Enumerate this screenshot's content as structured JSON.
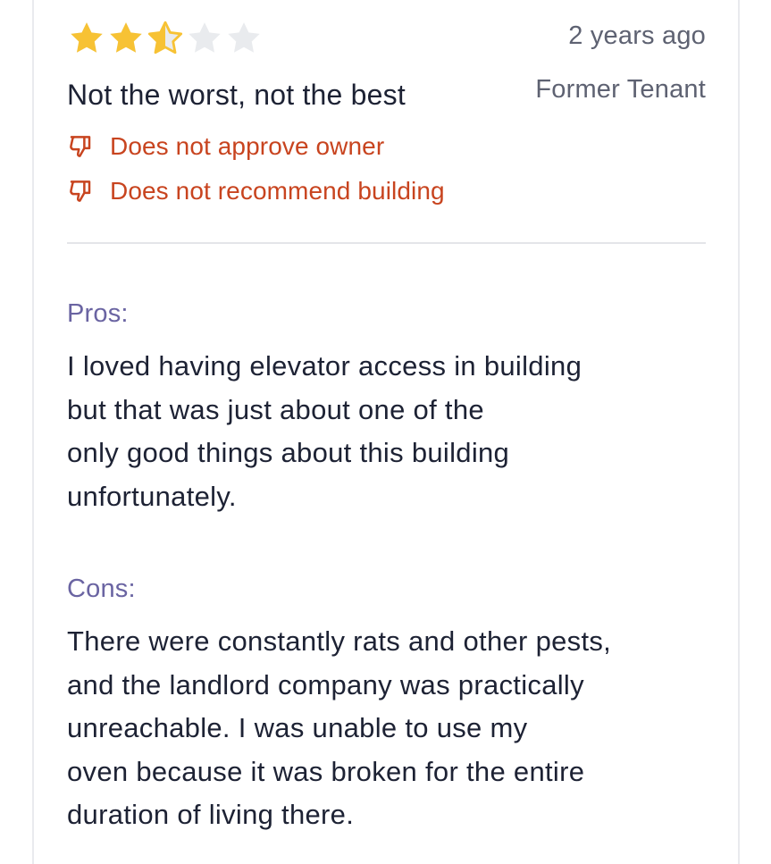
{
  "review": {
    "rating": 2.5,
    "max_rating": 5,
    "date": "2 years ago",
    "title": "Not the worst, not the best",
    "role": "Former Tenant",
    "flags": [
      {
        "icon": "thumbs-down-icon",
        "label": "Does not approve owner"
      },
      {
        "icon": "thumbs-down-icon",
        "label": "Does not recommend building"
      }
    ],
    "pros": {
      "label": "Pros:",
      "lines": [
        "I loved having elevator access in building",
        "but that was just about one of the",
        "only good things about this building",
        "unfortunately."
      ]
    },
    "cons": {
      "label": "Cons:",
      "lines": [
        "There were constantly rats and other pests,",
        "and the landlord company was practically",
        "unreachable. I was unable to use my",
        "oven because it was broken for the entire",
        "duration of living there."
      ]
    }
  },
  "colors": {
    "star_filled": "#f7c234",
    "star_empty": "#e9ebee",
    "flag_red": "#c8441f",
    "section_label": "#6a64a2",
    "text_primary": "#1d2234",
    "text_secondary": "#5e6272",
    "divider": "#e4e5e9"
  }
}
